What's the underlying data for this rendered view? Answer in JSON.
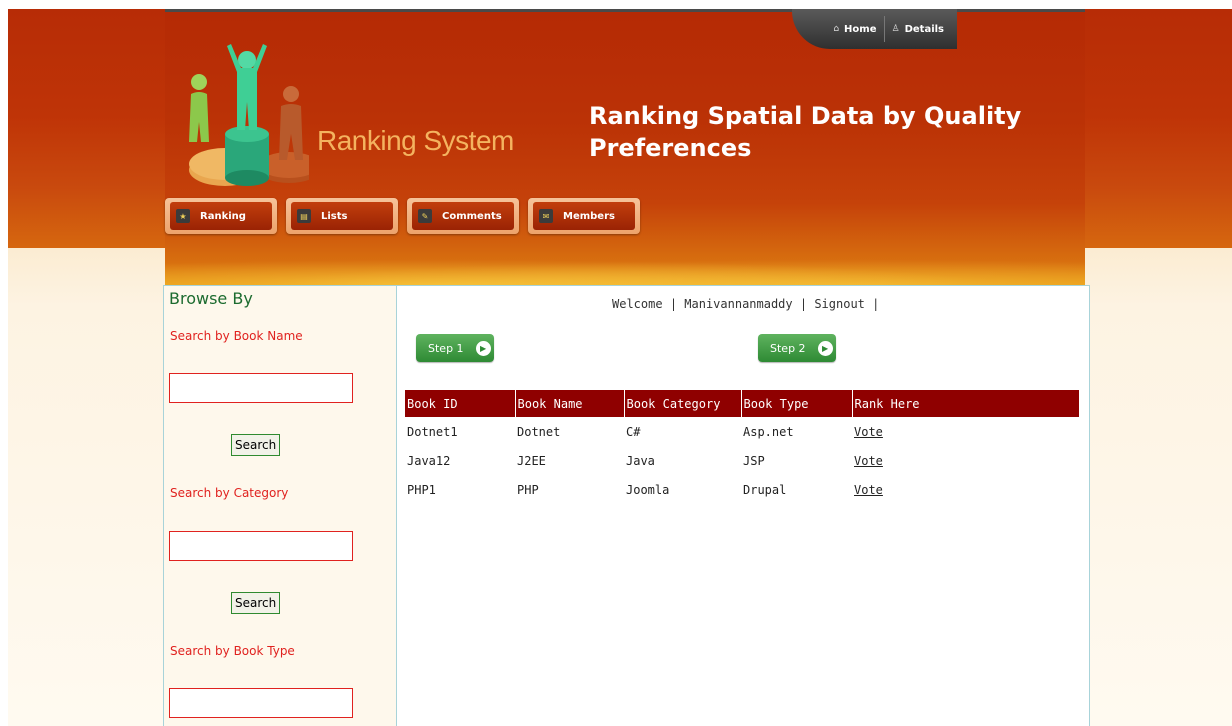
{
  "topnav": {
    "home": "Home",
    "details": "Details"
  },
  "logo": {
    "text": "Ranking System"
  },
  "site_title": "Ranking Spatial Data by Quality Preferences",
  "menu": [
    {
      "label": "Ranking",
      "icon": "ranking-icon"
    },
    {
      "label": "Lists",
      "icon": "lists-icon"
    },
    {
      "label": "Comments",
      "icon": "comments-icon"
    },
    {
      "label": "Members",
      "icon": "members-icon"
    }
  ],
  "sidebar": {
    "title": "Browse By",
    "book_name_label": "Search by Book Name",
    "category_label": "Search by Category",
    "book_type_label": "Search by Book Type",
    "search_button": "Search",
    "book_name_value": "",
    "category_value": "",
    "book_type_value": ""
  },
  "main": {
    "welcome": "Welcome",
    "username": "Manivannanmaddy",
    "signout": "Signout",
    "step1": "Step 1",
    "step2": "Step 2",
    "table": {
      "headers": [
        "Book ID",
        "Book Name",
        "Book Category",
        "Book Type",
        "Rank Here"
      ],
      "rows": [
        [
          "Dotnet1",
          "Dotnet",
          "C#",
          "Asp.net",
          "Vote"
        ],
        [
          "Java12",
          "J2EE",
          "Java",
          "JSP",
          "Vote"
        ],
        [
          "PHP1",
          "PHP",
          "Joomla",
          "Drupal",
          "Vote"
        ]
      ]
    }
  },
  "colors": {
    "header_red": "#b72c06",
    "table_header": "#8f0000",
    "label_red": "#e0221f",
    "browse_green": "#1c6b2f",
    "step_green": "#2e8a34"
  }
}
